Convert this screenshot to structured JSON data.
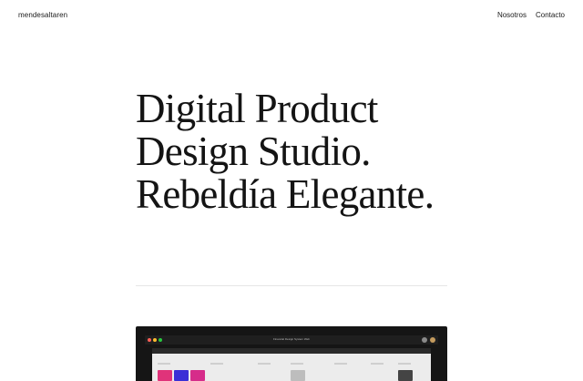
{
  "header": {
    "brand": "mendesaltaren",
    "nav": [
      {
        "label": "Nosotros"
      },
      {
        "label": "Contacto"
      }
    ]
  },
  "hero": {
    "lines": [
      "Digital Product",
      "Design Studio.",
      "Rebeldía Elegante."
    ]
  },
  "preview": {
    "window_title": "Financial Design System Web"
  },
  "colors": {
    "background": "#ffffff",
    "text": "#141414",
    "preview_background": "#151515"
  }
}
